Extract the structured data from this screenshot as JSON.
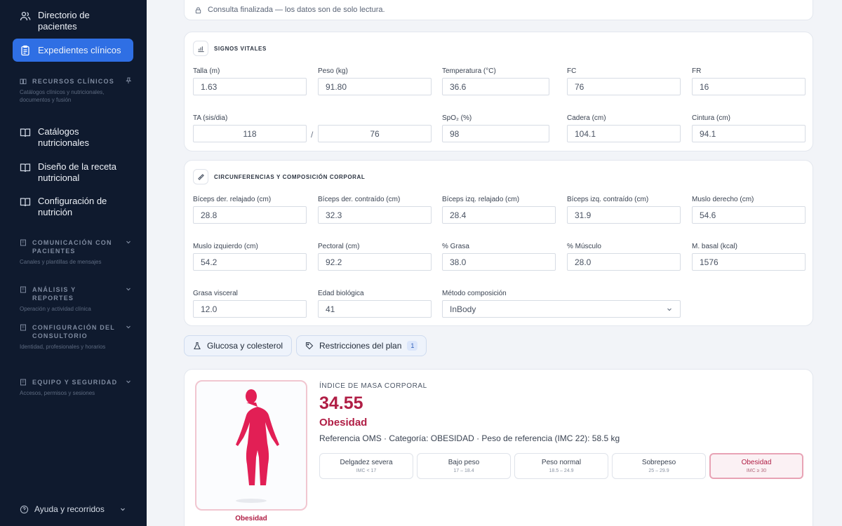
{
  "sidebar": {
    "items": [
      {
        "label": "Directorio de pacientes",
        "icon": "users-icon"
      },
      {
        "label": "Expedientes clínicos",
        "icon": "clipboard-icon",
        "active": true
      },
      {
        "label": "Catálogos nutricionales",
        "icon": "book-icon"
      },
      {
        "label": "Diseño de la receta nutricional",
        "icon": "book-icon"
      },
      {
        "label": "Configuración de nutrición",
        "icon": "book-icon"
      }
    ],
    "sections": [
      {
        "title": "RECURSOS CLÍNICOS",
        "desc": "Catálogos clínicos y nutricionales, documentos y fusión"
      },
      {
        "title": "COMUNICACIÓN CON PACIENTES",
        "desc": "Canales y plantillas de mensajes"
      },
      {
        "title": "ANÁLISIS Y REPORTES",
        "desc": "Operación y actividad clínica"
      },
      {
        "title": "CONFIGURACIÓN DEL CONSULTORIO",
        "desc": "Identidad, profesionales y horarios"
      },
      {
        "title": "EQUIPO Y SEGURIDAD",
        "desc": "Accesos, permisos y sesiones"
      }
    ],
    "help": "Ayuda y recorridos"
  },
  "notice": "Consulta finalizada — los datos son de solo lectura.",
  "vitals": {
    "title": "SIGNOS VITALES",
    "f": [
      {
        "label": "Talla (m)",
        "value": "1.63"
      },
      {
        "label": "Peso (kg)",
        "value": "91.80"
      },
      {
        "label": "Temperatura (°C)",
        "value": "36.6"
      },
      {
        "label": "FC",
        "value": "76"
      },
      {
        "label": "FR",
        "value": "16"
      },
      {
        "label": "TA (sis/dia)",
        "value": "118"
      },
      {
        "label": "",
        "value": "76"
      },
      {
        "label": "SpO₂ (%)",
        "value": "98"
      },
      {
        "label": "Cadera (cm)",
        "value": "104.1"
      },
      {
        "label": "Cintura (cm)",
        "value": "94.1"
      }
    ],
    "slash": "/"
  },
  "body": {
    "title": "CIRCUNFERENCIAS Y COMPOSICIÓN CORPORAL",
    "f": [
      {
        "label": "Bíceps der. relajado (cm)",
        "value": "28.8"
      },
      {
        "label": "Bíceps der. contraído (cm)",
        "value": "32.3"
      },
      {
        "label": "Bíceps izq. relajado (cm)",
        "value": "28.4"
      },
      {
        "label": "Bíceps izq. contraído (cm)",
        "value": "31.9"
      },
      {
        "label": "Muslo derecho (cm)",
        "value": "54.6"
      },
      {
        "label": "Muslo izquierdo (cm)",
        "value": "54.2"
      },
      {
        "label": "Pectoral (cm)",
        "value": "92.2"
      },
      {
        "label": "% Grasa",
        "value": "38.0"
      },
      {
        "label": "% Músculo",
        "value": "28.0"
      },
      {
        "label": "M. basal (kcal)",
        "value": "1576"
      },
      {
        "label": "Grasa visceral",
        "value": "12.0"
      },
      {
        "label": "Edad biológica",
        "value": "41"
      },
      {
        "label": "Método composición",
        "value": "InBody"
      }
    ]
  },
  "tabs": {
    "glucose": "Glucosa y colesterol",
    "restrictions": "Restricciones del plan",
    "restrictions_count": "1"
  },
  "bmi": {
    "label": "ÍNDICE DE MASA CORPORAL",
    "value": "34.55",
    "category": "Obesidad",
    "reference": "Referencia OMS · Categoría: OBESIDAD · Peso de referencia (IMC 22): 58.5 kg",
    "figure_caption": "Obesidad",
    "accent": "#b01e45",
    "scale": [
      {
        "name": "Delgadez severa",
        "range": "IMC < 17"
      },
      {
        "name": "Bajo peso",
        "range": "17 – 18.4"
      },
      {
        "name": "Peso normal",
        "range": "18.5 – 24.9"
      },
      {
        "name": "Sobrepeso",
        "range": "25 – 29.9"
      },
      {
        "name": "Obesidad",
        "range": "IMC ≥ 30",
        "active": true
      }
    ]
  }
}
